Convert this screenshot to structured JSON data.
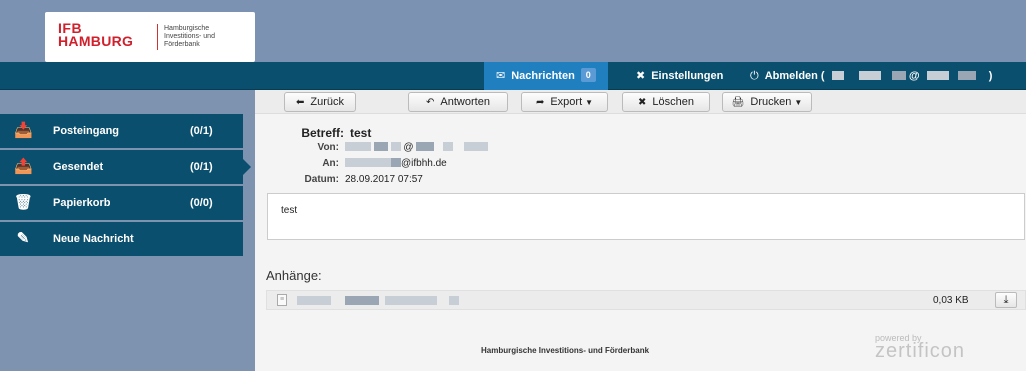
{
  "logo": {
    "line1": "IFB",
    "line2": "HAMBURG",
    "tag1": "Hamburgische",
    "tag2": "Investitions- und",
    "tag3": "Förderbank"
  },
  "nav": {
    "messages_label": "Nachrichten",
    "messages_count": "0",
    "settings_label": "Einstellungen",
    "logout_label": "Abmelden (",
    "logout_close": ")",
    "logout_at": "@"
  },
  "sidebar": {
    "items": [
      {
        "label": "Posteingang",
        "count": "(0/1)",
        "icon": "inbox-icon"
      },
      {
        "label": "Gesendet",
        "count": "(0/1)",
        "icon": "outbox-icon"
      },
      {
        "label": "Papierkorb",
        "count": "(0/0)",
        "icon": "trash-icon"
      },
      {
        "label": "Neue Nachricht",
        "count": "",
        "icon": "compose-icon"
      }
    ]
  },
  "toolbar": {
    "back": "Zurück",
    "reply": "Antworten",
    "export": "Export",
    "delete": "Löschen",
    "print": "Drucken"
  },
  "message": {
    "subject_label": "Betreff:",
    "subject": "test",
    "from_label": "Von:",
    "from_at": "@",
    "to_label": "An:",
    "to_domain": "@ifbhh.de",
    "date_label": "Datum:",
    "date": "28.09.2017 07:57",
    "body": "test"
  },
  "attachments": {
    "title": "Anhänge:",
    "items": [
      {
        "size": "0,03 KB"
      }
    ]
  },
  "footer": {
    "bank_name": "Hamburgische Investitions- und Förderbank",
    "powered_by": "powered by",
    "brand": "zertificon"
  }
}
